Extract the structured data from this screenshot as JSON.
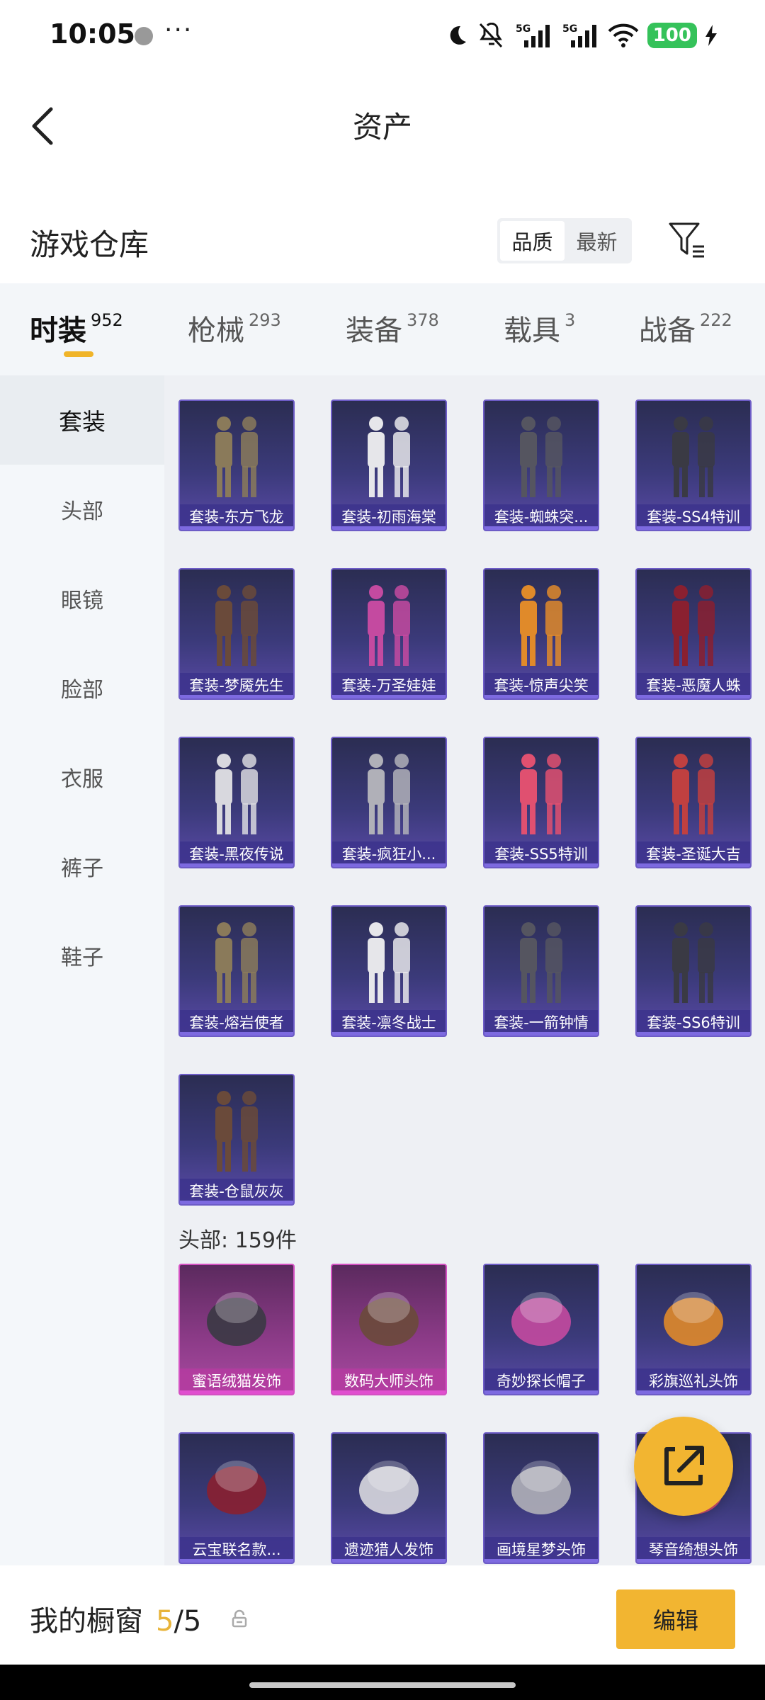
{
  "status_bar": {
    "time": "10:05",
    "dots": "···",
    "battery": "100",
    "net1": "5G",
    "net2": "5G"
  },
  "header": {
    "title": "资产"
  },
  "section": {
    "title": "游戏仓库",
    "sort_quality": "品质",
    "sort_newest": "最新"
  },
  "tabs": [
    {
      "label": "时装",
      "count": "952"
    },
    {
      "label": "枪械",
      "count": "293"
    },
    {
      "label": "装备",
      "count": "378"
    },
    {
      "label": "载具",
      "count": "3"
    },
    {
      "label": "战备",
      "count": "222"
    }
  ],
  "sidebar": {
    "items": [
      "套装",
      "头部",
      "眼镜",
      "脸部",
      "衣服",
      "裤子",
      "鞋子"
    ]
  },
  "suits": [
    "套装-东方飞龙",
    "套装-初雨海棠",
    "套装-蜘蛛突...",
    "套装-SS4特训",
    "套装-梦魇先生",
    "套装-万圣娃娃",
    "套装-惊声尖笑",
    "套装-恶魔人蛛",
    "套装-黑夜传说",
    "套装-疯狂小...",
    "套装-SS5特训",
    "套装-圣诞大吉",
    "套装-熔岩使者",
    "套装-凛冬战士",
    "套装-一箭钟情",
    "套装-SS6特训",
    "套装-仓鼠灰灰"
  ],
  "head_section": {
    "title": "头部: 159件"
  },
  "heads": [
    "蜜语绒猫发饰",
    "数码大师头饰",
    "奇妙探长帽子",
    "彩旗巡礼头饰",
    "云宝联名款...",
    "遗迹猎人发饰",
    "画境星梦头饰",
    "琴音绮想头饰"
  ],
  "bottom": {
    "label": "我的橱窗",
    "count_current": "5",
    "count_total": "/5",
    "edit": "编辑"
  },
  "colors": {
    "accent": "#f2b531",
    "card_purple": "#3b3a7a",
    "card_pink": "#8a3a86"
  }
}
